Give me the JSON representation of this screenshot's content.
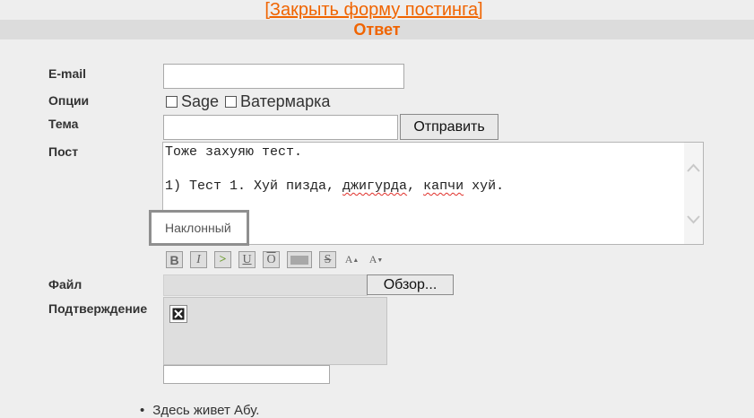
{
  "header": {
    "close_link": "[Закрыть форму постинга]",
    "title": "Ответ"
  },
  "form": {
    "email_label": "E-mail",
    "email_value": "",
    "options_label": "Опции",
    "options": [
      {
        "label": "Sage",
        "checked": false
      },
      {
        "label": "Ватермарка",
        "checked": false
      }
    ],
    "subject_label": "Тема",
    "subject_value": "",
    "submit_label": "Отправить",
    "post_label": "Пост",
    "post_line1": "Тоже захуяю тест.",
    "post_line3_pre": "1) Тест 1. Хуй пизда, ",
    "post_word_a": "джигурда",
    "post_mid": ", ",
    "post_word_b": "капчи",
    "post_end": " хуй.",
    "tooltip": "Наклонный",
    "file_label": "Файл",
    "browse_label": "Обзор...",
    "captcha_label": "Подтверждение",
    "captcha_value": ""
  },
  "toolbar": {
    "buttons": [
      {
        "name": "bold",
        "glyph": "B"
      },
      {
        "name": "italic",
        "glyph": "I"
      },
      {
        "name": "quote",
        "glyph": ">"
      },
      {
        "name": "underline",
        "glyph": "U"
      },
      {
        "name": "overline",
        "glyph": "O"
      },
      {
        "name": "spoiler",
        "glyph": ""
      },
      {
        "name": "strike",
        "glyph": "S"
      },
      {
        "name": "superscript",
        "glyph": "A"
      },
      {
        "name": "subscript",
        "glyph": "A"
      }
    ]
  },
  "footer": {
    "items": [
      "Здесь живет Абу."
    ]
  },
  "colors": {
    "accent": "#f06400",
    "background": "#eeeeee",
    "bar": "#dcdcdc"
  }
}
